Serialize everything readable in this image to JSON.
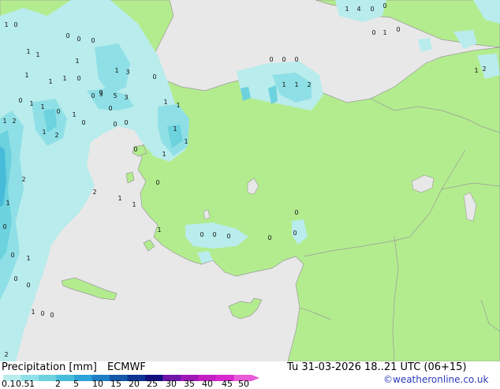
{
  "title": "Precipitation [mm]",
  "model": "ECMWF",
  "valid_time": "Tu 31-03-2026 18..21 UTC (06+15)",
  "credit": "©weatheronline.co.uk",
  "colors": {
    "sea": "#e8e8e8",
    "land": "#b3ec8e",
    "border": "#9a9a9a",
    "accent": "#2b3bb8"
  },
  "legend": {
    "ticks": [
      "0.1",
      "0.5",
      "1",
      "2",
      "5",
      "10",
      "15",
      "20",
      "25",
      "30",
      "35",
      "40",
      "45",
      "50"
    ],
    "colors": [
      "#b9ecec",
      "#8fe0e6",
      "#6cd2de",
      "#46bcda",
      "#2ba3d6",
      "#1c7fc4",
      "#1456a8",
      "#0c3490",
      "#12107e",
      "#6e14a8",
      "#9e18b8",
      "#c21ec2",
      "#d628cc",
      "#e85ad8"
    ]
  },
  "map_labels": [
    {
      "text": "1"
    },
    {
      "text": "4"
    },
    {
      "text": "0"
    },
    {
      "text": "0"
    },
    {
      "text": "0"
    },
    {
      "text": "1"
    },
    {
      "text": "0"
    },
    {
      "text": "1"
    },
    {
      "text": "0"
    },
    {
      "text": "1"
    },
    {
      "text": "1"
    },
    {
      "text": "1"
    },
    {
      "text": "0"
    },
    {
      "text": "0"
    },
    {
      "text": "0"
    },
    {
      "text": "1"
    },
    {
      "text": "0"
    },
    {
      "text": "1"
    },
    {
      "text": "3"
    },
    {
      "text": "0"
    },
    {
      "text": "1"
    },
    {
      "text": "1"
    },
    {
      "text": "0"
    },
    {
      "text": "1"
    },
    {
      "text": "1"
    },
    {
      "text": "0"
    },
    {
      "text": "1"
    },
    {
      "text": "0"
    },
    {
      "text": "0"
    },
    {
      "text": "3"
    },
    {
      "text": "5"
    },
    {
      "text": "3"
    },
    {
      "text": "1"
    },
    {
      "text": "2"
    },
    {
      "text": "0"
    },
    {
      "text": "0"
    },
    {
      "text": "0"
    },
    {
      "text": "1"
    },
    {
      "text": "1"
    },
    {
      "text": "1"
    },
    {
      "text": "1"
    },
    {
      "text": "1"
    },
    {
      "text": "0"
    },
    {
      "text": "1"
    },
    {
      "text": "2"
    },
    {
      "text": "2"
    },
    {
      "text": "1"
    },
    {
      "text": "0"
    },
    {
      "text": "1"
    },
    {
      "text": "1"
    },
    {
      "text": "2"
    },
    {
      "text": "0"
    },
    {
      "text": "0"
    },
    {
      "text": "0"
    },
    {
      "text": "0"
    },
    {
      "text": "0"
    },
    {
      "text": "0"
    },
    {
      "text": "0"
    },
    {
      "text": "0"
    },
    {
      "text": "0"
    },
    {
      "text": "1"
    },
    {
      "text": "0"
    },
    {
      "text": "0"
    },
    {
      "text": "1"
    },
    {
      "text": "0"
    },
    {
      "text": "0"
    },
    {
      "text": "0"
    },
    {
      "text": "0"
    },
    {
      "text": "1"
    },
    {
      "text": "2"
    },
    {
      "text": "1"
    },
    {
      "text": "1"
    },
    {
      "text": "2"
    },
    {
      "text": "1"
    },
    {
      "text": "2"
    },
    {
      "text": "0"
    }
  ]
}
